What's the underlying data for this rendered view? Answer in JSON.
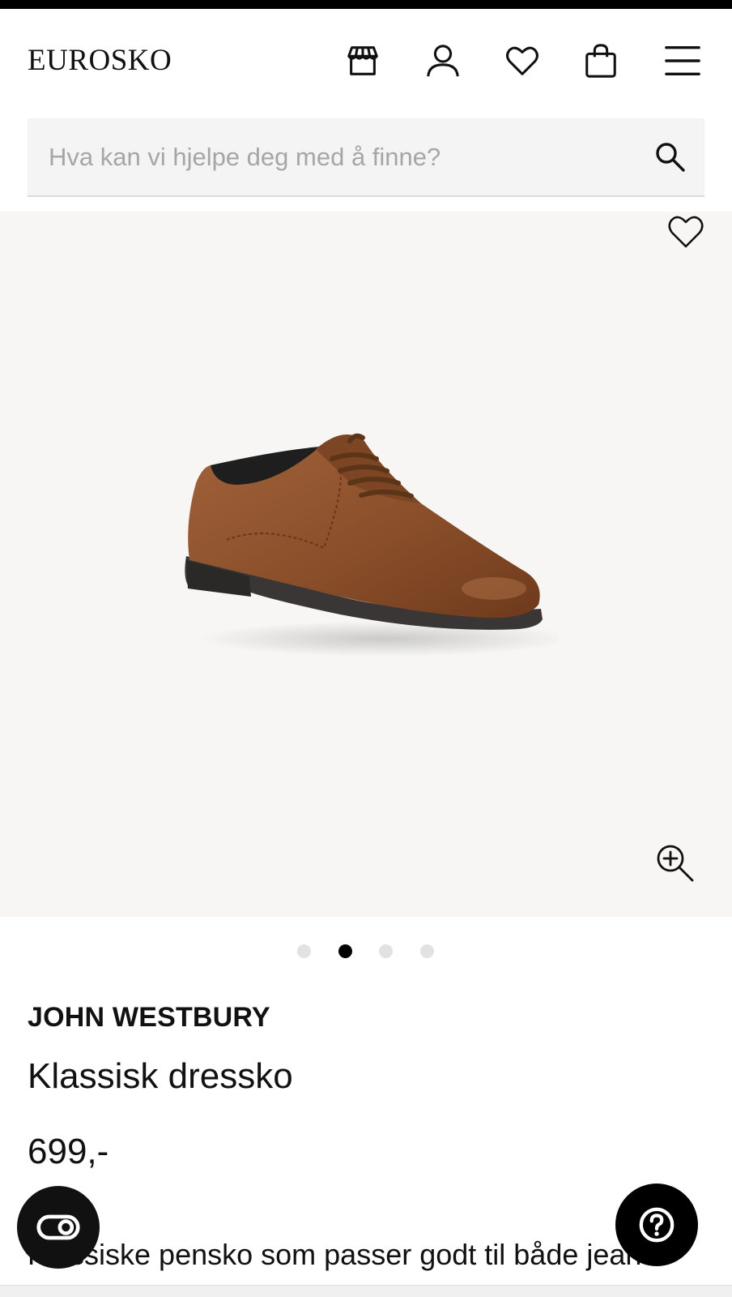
{
  "header": {
    "logo": "EUROSKO",
    "icons": [
      "store-icon",
      "account-icon",
      "wishlist-icon",
      "cart-icon",
      "menu-icon"
    ]
  },
  "search": {
    "placeholder": "Hva kan vi hjelpe deg med å finne?",
    "value": ""
  },
  "gallery": {
    "active_slide": 2,
    "slide_count": 4,
    "image_alt": "Brown leather lace-up shoe"
  },
  "product": {
    "brand": "JOHN WESTBURY",
    "name": "Klassisk dressko",
    "price": "699,-",
    "description": "Klassiske pensko som passer godt til både jeans"
  },
  "colors": {
    "accent": "#000000",
    "gallery_bg": "#f7f6f4",
    "search_bg": "#f4f4f4",
    "shoe_leather": "#8a4f2a"
  }
}
